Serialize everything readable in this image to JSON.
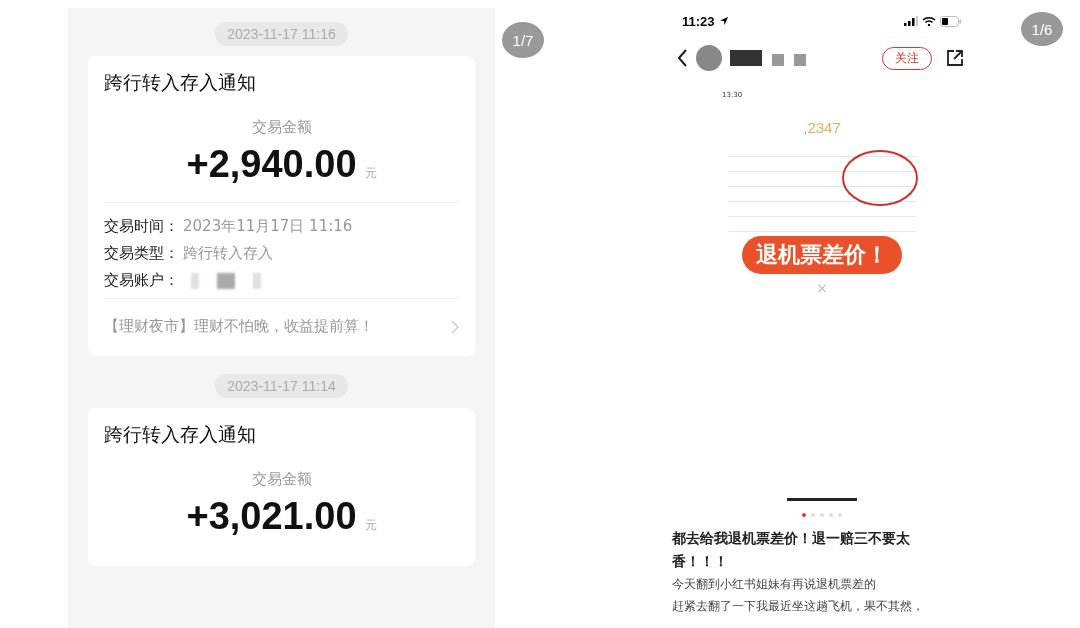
{
  "left_panel": {
    "page_badge": "1/7",
    "messages": [
      {
        "timestamp": "2023-11-17 11:16",
        "title": "跨行转入存入通知",
        "amount_label": "交易金额",
        "amount": "+2,940.00",
        "currency": "元",
        "details": [
          {
            "label": "交易时间：",
            "value": "2023年11月17日 11:16",
            "blurred": false
          },
          {
            "label": "交易类型：",
            "value": "跨行转入存入",
            "blurred": false
          },
          {
            "label": "交易账户：",
            "blurred": true
          }
        ],
        "promo": "【理财夜市】理财不怕晚，收益提前算！"
      },
      {
        "timestamp": "2023-11-17 11:14",
        "title": "跨行转入存入通知",
        "amount_label": "交易金额",
        "amount": "+3,021.00",
        "currency": "元"
      }
    ]
  },
  "right_panel": {
    "page_badge": "1/6",
    "status_bar": {
      "time": "11:23"
    },
    "header": {
      "follow_button": "关注"
    },
    "post_image": {
      "inner_time": "13:30",
      "total": ",2347",
      "sticker": "退机票差价！",
      "close": "×"
    },
    "carousel_dots": [
      {
        "selected": true
      },
      {
        "selected": false
      },
      {
        "selected": false
      },
      {
        "selected": false
      },
      {
        "selected": false
      }
    ],
    "post_title": "都去给我退机票差价！退一赔三不要太香！！！",
    "post_body": [
      "今天翻到小红书姐妹有再说退机票差的",
      "赶紧去翻了一下我最近坐这趟飞机，果不其然，"
    ]
  }
}
